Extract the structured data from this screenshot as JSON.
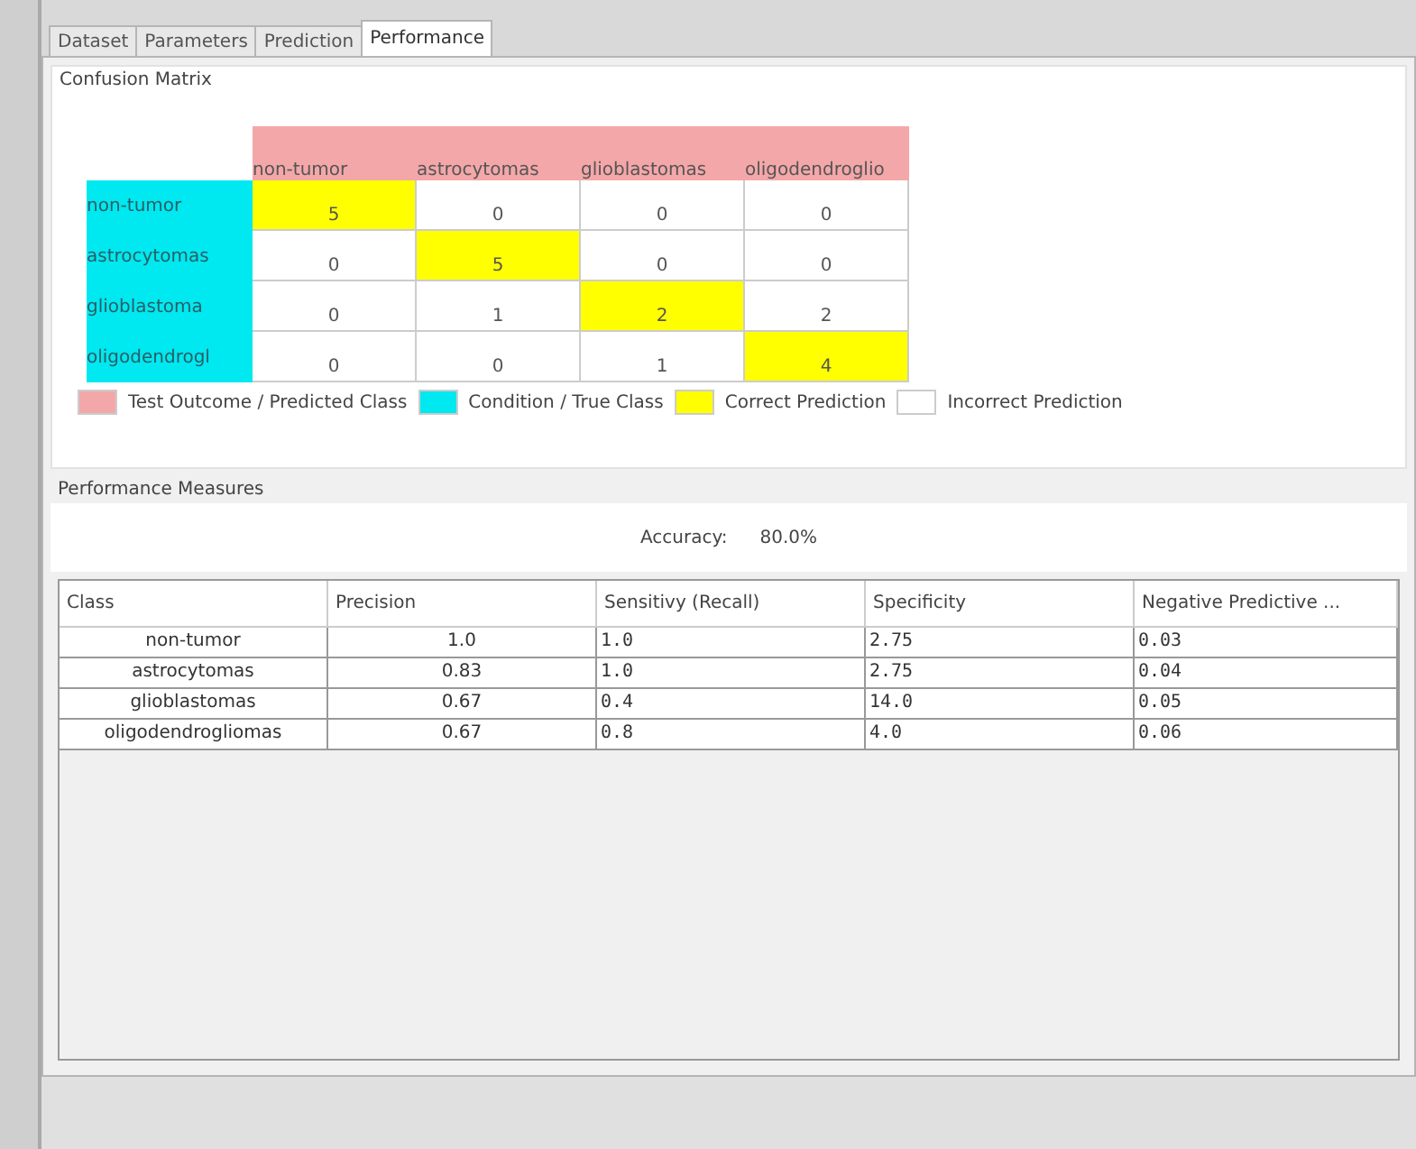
{
  "tabs": [
    {
      "label": "Dataset",
      "selected": false
    },
    {
      "label": "Parameters",
      "selected": false
    },
    {
      "label": "Prediction",
      "selected": false
    },
    {
      "label": "Performance",
      "selected": true
    }
  ],
  "confusion_matrix": {
    "title": "Confusion Matrix",
    "columns": [
      "non-tumor",
      "astrocytomas",
      "glioblastomas",
      "oligodendroglio"
    ],
    "rows": [
      {
        "label": "non-tumor",
        "cells": [
          {
            "value": "5",
            "correct": true
          },
          {
            "value": "0",
            "correct": false
          },
          {
            "value": "0",
            "correct": false
          },
          {
            "value": "0",
            "correct": false
          }
        ]
      },
      {
        "label": "astrocytomas",
        "cells": [
          {
            "value": "0",
            "correct": false
          },
          {
            "value": "5",
            "correct": true
          },
          {
            "value": "0",
            "correct": false
          },
          {
            "value": "0",
            "correct": false
          }
        ]
      },
      {
        "label": "glioblastoma",
        "cells": [
          {
            "value": "0",
            "correct": false
          },
          {
            "value": "1",
            "correct": false
          },
          {
            "value": "2",
            "correct": true
          },
          {
            "value": "2",
            "correct": false
          }
        ]
      },
      {
        "label": "oligodendrogl",
        "cells": [
          {
            "value": "0",
            "correct": false
          },
          {
            "value": "0",
            "correct": false
          },
          {
            "value": "1",
            "correct": false
          },
          {
            "value": "4",
            "correct": true
          }
        ]
      }
    ],
    "legend": [
      {
        "label": "Test Outcome / Predicted Class",
        "color": "#f4a7a9"
      },
      {
        "label": "Condition / True Class",
        "color": "#00e8f0"
      },
      {
        "label": "Correct Prediction",
        "color": "#ffff00"
      },
      {
        "label": "Incorrect Prediction",
        "color": "#ffffff"
      }
    ]
  },
  "performance": {
    "title": "Performance Measures",
    "accuracy_label": "Accuracy:",
    "accuracy_value": "80.0%",
    "columns": [
      "Class",
      "Precision",
      "Sensitivy (Recall)",
      "Specificity",
      "Negative Predictive ..."
    ],
    "rows": [
      [
        "non-tumor",
        "1.0",
        "1.0",
        "2.75",
        "0.03"
      ],
      [
        "astrocytomas",
        "0.83",
        "1.0",
        "2.75",
        "0.04"
      ],
      [
        "glioblastomas",
        "0.67",
        "0.4",
        "14.0",
        "0.05"
      ],
      [
        "oligodendrogliomas",
        "0.67",
        "0.8",
        "4.0",
        "0.06"
      ]
    ]
  }
}
